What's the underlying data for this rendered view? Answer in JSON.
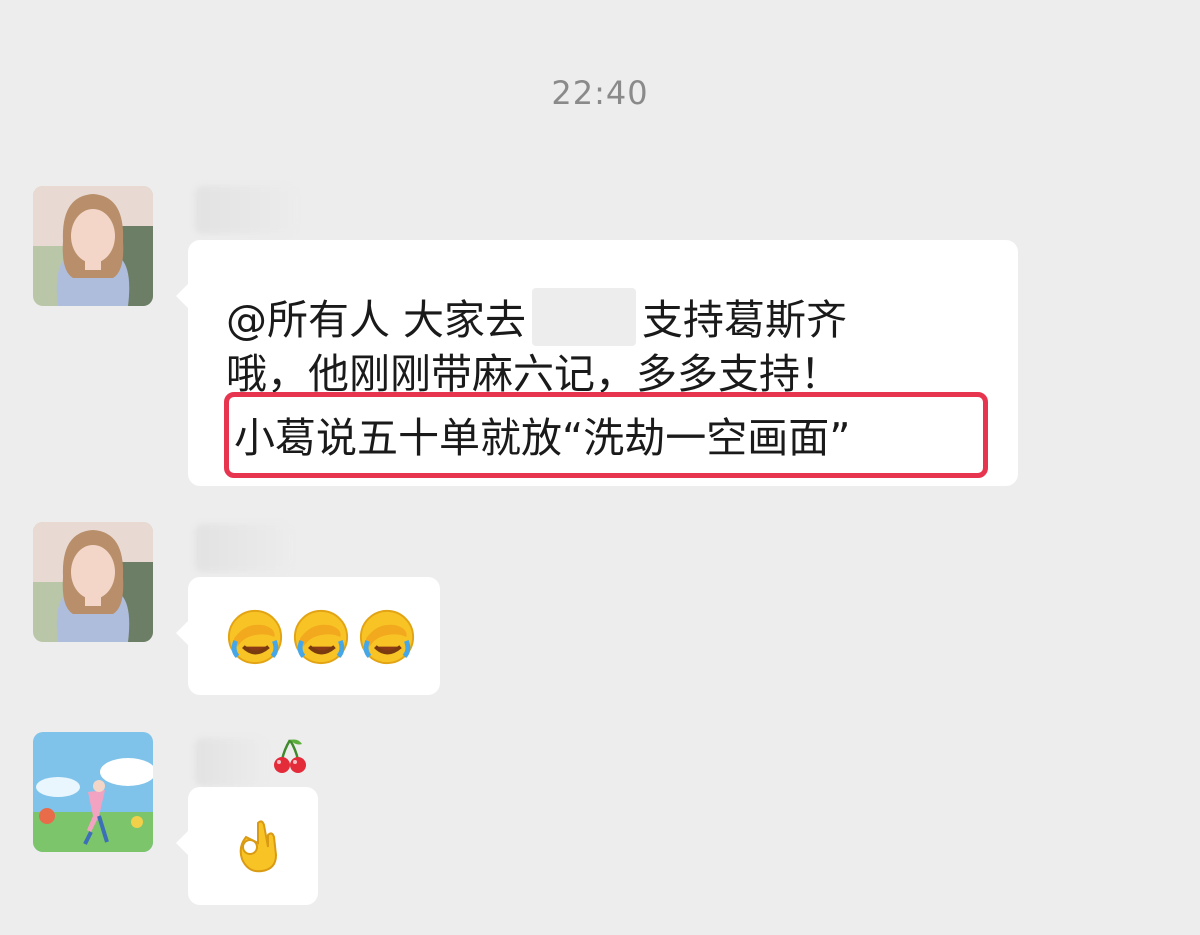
{
  "chat": {
    "timestamp": "22:40",
    "messages": [
      {
        "sender": "avatar-woman",
        "line1_a": "@所有人  大家去",
        "line1_b": "支持葛斯齐",
        "line2": "哦，他刚刚带麻六记，多多支持！",
        "line3": "小葛说五十单就放“洗劫一空画面”"
      },
      {
        "sender": "avatar-woman",
        "emojis": [
          "facepalm-laugh-emoji",
          "facepalm-laugh-emoji",
          "facepalm-laugh-emoji"
        ]
      },
      {
        "sender": "avatar-landscape",
        "name_emoji": "🍒",
        "emoji": "👌"
      }
    ]
  },
  "colors": {
    "background": "#ededed",
    "bubble": "#ffffff",
    "highlight": "#e8354f",
    "timestamp": "#8a8a8a"
  }
}
